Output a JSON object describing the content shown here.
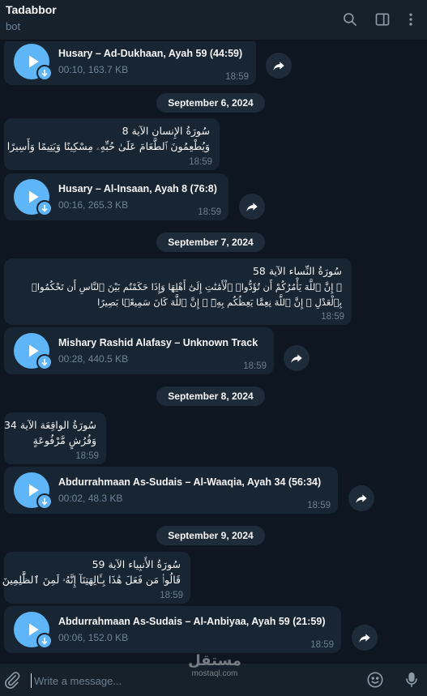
{
  "header": {
    "title": "Tadabbor",
    "subtitle": "bot",
    "icons": [
      "search-icon",
      "sidebar-toggle-icon",
      "more-vertical-icon"
    ]
  },
  "messages": [
    {
      "type": "audio",
      "title": "Husary – Ad-Dukhaan, Ayah 59 (44:59)",
      "meta": "00:10, 163.7 KB",
      "time": "18:59"
    },
    {
      "type": "date",
      "label": "September 6, 2024"
    },
    {
      "type": "text",
      "lines": [
        "سُورَةُ الإِنسان الآية 8",
        "وَيُطْعِمُونَ ٱلطَّعَامَ عَلَىٰ حُبِّهِۦ مِسْكِينًا وَيَتِيمًا وَأَسِيرًا"
      ],
      "time": "18:59"
    },
    {
      "type": "audio",
      "title": "Husary – Al-Insaan, Ayah 8 (76:8)",
      "meta": "00:16, 265.3 KB",
      "time": "18:59"
    },
    {
      "type": "date",
      "label": "September 7, 2024"
    },
    {
      "type": "text",
      "lines": [
        "سُورَةُ النِّساء الآية 58",
        "۞ إِنَّ ٱللَّهَ يَأْمُرُكُمْ أَن تُؤَدُّوا۟ ٱلْأَمَٰنَٰتِ إِلَىٰٓ أَهْلِهَا وَإِذَا حَكَمْتُم بَيْنَ ٱلنَّاسِ أَن تَحْكُمُوا۟",
        "بِٱلْعَدْلِ ۚ إِنَّ ٱللَّهَ نِعِمَّا يَعِظُكُم بِهِۦٓ ۗ إِنَّ ٱللَّهَ كَانَ سَمِيعًۢا بَصِيرًا"
      ],
      "time": "18:59"
    },
    {
      "type": "audio",
      "title": "Mishary Rashid Alafasy – Unknown Track",
      "meta": "00:28, 440.5 KB",
      "time": "18:59"
    },
    {
      "type": "date",
      "label": "September 8, 2024"
    },
    {
      "type": "text",
      "lines": [
        "سُورَةُ الواقِعَة الآية 34",
        "وَفُرُشٍ مَّرْفُوعَةٍ"
      ],
      "time": "18:59"
    },
    {
      "type": "audio",
      "title": "Abdurrahmaan As-Sudais – Al-Waaqia, Ayah 34 (56:34)",
      "meta": "00:02, 48.3 KB",
      "time": "18:59"
    },
    {
      "type": "date",
      "label": "September 9, 2024"
    },
    {
      "type": "text",
      "lines": [
        "سُورَةُ الأَنبِياء الآية 59",
        "قَالُوا۟ مَن فَعَلَ هَٰذَا بِـَٔالِهَتِنَآ إِنَّهُۥ لَمِنَ ٱلظَّٰلِمِينَ"
      ],
      "time": "18:59"
    },
    {
      "type": "audio",
      "title": "Abdurrahmaan As-Sudais – Al-Anbiyaa, Ayah 59 (21:59)",
      "meta": "00:06, 152.0 KB",
      "time": "18:59"
    }
  ],
  "composer": {
    "placeholder": "Write a message...",
    "icons": [
      "attach-icon",
      "emoji-icon",
      "microphone-icon"
    ]
  },
  "watermark": {
    "line1": "مستقل",
    "line2": "mostaql.com"
  },
  "colors": {
    "background": "#0e1621",
    "header": "#17212b",
    "bubble": "#182533",
    "accent": "#5eb5f7",
    "muted": "#708499"
  }
}
